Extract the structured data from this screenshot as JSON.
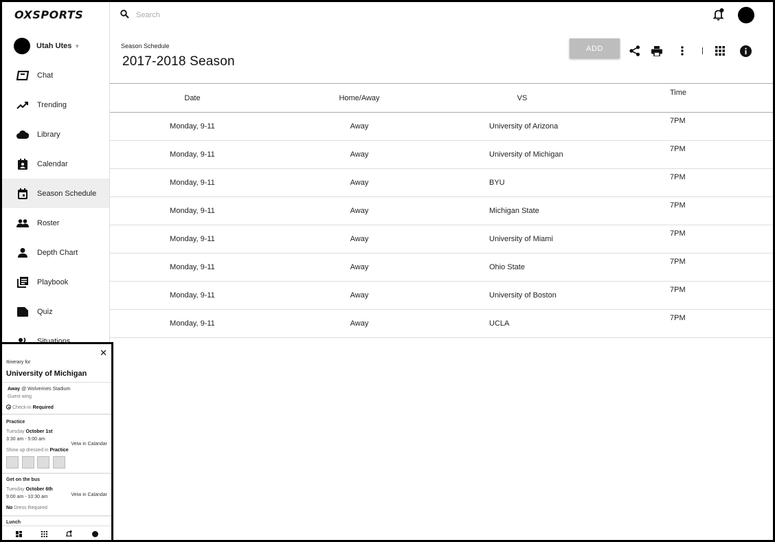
{
  "brand": {
    "logo": "OXSPORTS"
  },
  "team": {
    "name": "Utah Utes"
  },
  "sidebar": {
    "items": [
      {
        "label": "Chat",
        "icon": "chat-icon"
      },
      {
        "label": "Trending",
        "icon": "trending-icon"
      },
      {
        "label": "Library",
        "icon": "cloud-icon"
      },
      {
        "label": "Calendar",
        "icon": "calendar-contact-icon"
      },
      {
        "label": "Season Schedule",
        "icon": "event-icon",
        "active": true
      },
      {
        "label": "Roster",
        "icon": "people-icon"
      },
      {
        "label": "Depth Chart",
        "icon": "person-icon"
      },
      {
        "label": "Playbook",
        "icon": "playbook-icon"
      },
      {
        "label": "Quiz",
        "icon": "label-icon"
      },
      {
        "label": "Situations",
        "icon": "situations-icon"
      }
    ]
  },
  "search": {
    "placeholder": "Search"
  },
  "page": {
    "eyebrow": "Season Schedule",
    "title": "2017-2018 Season"
  },
  "toolbar": {
    "add_label": "ADD"
  },
  "schedule": {
    "columns": [
      "Date",
      "Home/Away",
      "VS",
      "Time"
    ],
    "rows": [
      {
        "date": "Monday, 9-11",
        "home_away": "Away",
        "vs": "University of Arizona",
        "time": "7PM"
      },
      {
        "date": "Monday, 9-11",
        "home_away": "Away",
        "vs": "University of Michigan",
        "time": "7PM"
      },
      {
        "date": "Monday, 9-11",
        "home_away": "Away",
        "vs": "BYU",
        "time": "7PM"
      },
      {
        "date": "Monday, 9-11",
        "home_away": "Away",
        "vs": "Michigan State",
        "time": "7PM"
      },
      {
        "date": "Monday, 9-11",
        "home_away": "Away",
        "vs": "University of Miami",
        "time": "7PM"
      },
      {
        "date": "Monday, 9-11",
        "home_away": "Away",
        "vs": "Ohio State",
        "time": "7PM"
      },
      {
        "date": "Monday, 9-11",
        "home_away": "Away",
        "vs": "University of Boston",
        "time": "7PM"
      },
      {
        "date": "Monday, 9-11",
        "home_away": "Away",
        "vs": "UCLA",
        "time": "7PM"
      }
    ]
  },
  "itinerary": {
    "eyebrow": "Itinerary for",
    "title": "University of Michigan",
    "location_type": "Away",
    "location_rest": "@ Wolverines Stadium",
    "sub_location": "Guest wing",
    "checkin_prefix": "Check-in",
    "checkin_value": "Required",
    "practice": {
      "heading": "Practice",
      "day": "Tuesday",
      "date": "October 1st",
      "time": "3:30 am - 5:00 am",
      "link": "Veiw in Calandar",
      "dress_prefix": "Show up dressed in",
      "dress_value": "Practice"
    },
    "bus": {
      "heading": "Get on the bus",
      "day": "Tuesday",
      "date": "October 6th",
      "time": "9:00 am - 10:30 am",
      "link": "Veiw in Calandar",
      "dress_prefix": "No",
      "dress_value": "Dress Required"
    },
    "lunch": {
      "heading": "Lunch"
    }
  }
}
